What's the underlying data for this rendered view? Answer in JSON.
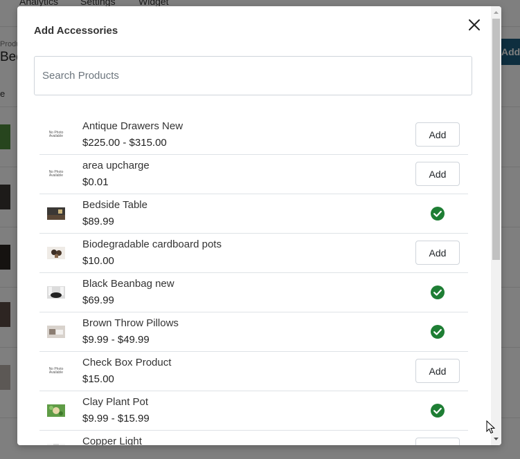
{
  "background": {
    "tabs": [
      "Analytics",
      "Settings",
      "Widget"
    ],
    "breadcrumb": "Produ",
    "title": "Bed",
    "add_button": "Add",
    "column": "e"
  },
  "modal": {
    "title": "Add Accessories",
    "search_placeholder": "Search Products",
    "add_label": "Add",
    "no_photo_text": "No Photo Available",
    "products": [
      {
        "name": "Antique Drawers New",
        "price": "$225.00 - $315.00",
        "photo": "none",
        "added": false
      },
      {
        "name": "area upcharge",
        "price": "$0.01",
        "photo": "none",
        "added": false
      },
      {
        "name": "Bedside Table",
        "price": "$89.99",
        "photo": "image",
        "added": true
      },
      {
        "name": "Biodegradable cardboard pots",
        "price": "$10.00",
        "photo": "image",
        "added": false
      },
      {
        "name": "Black Beanbag new",
        "price": "$69.99",
        "photo": "image",
        "added": true
      },
      {
        "name": "Brown Throw Pillows",
        "price": "$9.99 - $49.99",
        "photo": "image",
        "added": true
      },
      {
        "name": "Check Box Product",
        "price": "$15.00",
        "photo": "none",
        "added": false
      },
      {
        "name": "Clay Plant Pot",
        "price": "$9.99 - $15.99",
        "photo": "image",
        "added": true
      },
      {
        "name": "Copper Light",
        "price": "",
        "photo": "image",
        "added": false
      }
    ]
  },
  "colors": {
    "check_green": "#1e7e34",
    "bg_button": "#1c5c7e"
  },
  "icons": {
    "close": "close-icon",
    "added": "check-circle-icon"
  }
}
